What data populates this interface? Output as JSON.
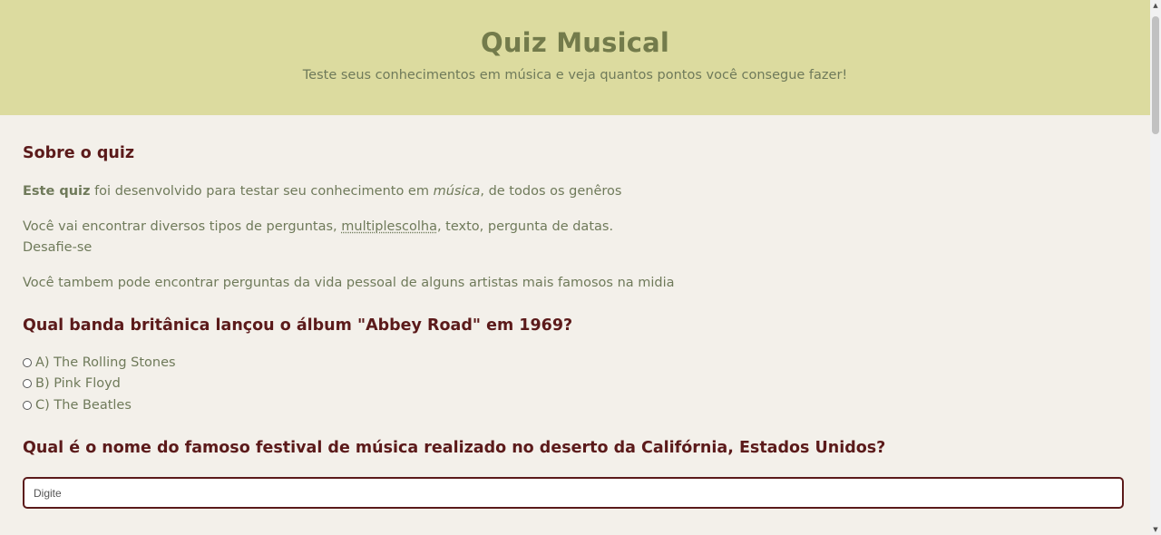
{
  "header": {
    "title": "Quiz Musical",
    "subtitle": "Teste seus conhecimentos em música e veja quantos pontos você consegue fazer!"
  },
  "about": {
    "heading": "Sobre o quiz",
    "line1_bold": "Este quiz",
    "line1_a": " foi desenvolvido para testar seu conhecimento em ",
    "line1_em": "música",
    "line1_b": ", de todos os genêros",
    "line2_a": "Você vai encontrar diversos tipos de perguntas, ",
    "line2_underlined": "multiplescolha",
    "line2_b": ", texto, pergunta de datas.",
    "line3": "Desafie-se",
    "line4": "Você tambem pode encontrar perguntas da vida pessoal de alguns artistas mais famosos na midia"
  },
  "question1": {
    "text": "Qual banda britânica lançou o álbum \"Abbey Road\" em 1969?",
    "options": [
      "A) The Rolling Stones",
      "B) Pink Floyd",
      "C) The Beatles"
    ]
  },
  "question2": {
    "text": "Qual é o nome do famoso festival de música realizado no deserto da Califórnia, Estados Unidos?",
    "placeholder": "Digite"
  },
  "colors": {
    "banner": "#dcdb9f",
    "title": "#737b4b",
    "heading": "#5b1a1a",
    "body_text": "#6f7a5a",
    "background": "#f3f0ea"
  },
  "icons": {
    "scroll_up": "triangle-up-icon",
    "scroll_down": "triangle-down-icon"
  }
}
